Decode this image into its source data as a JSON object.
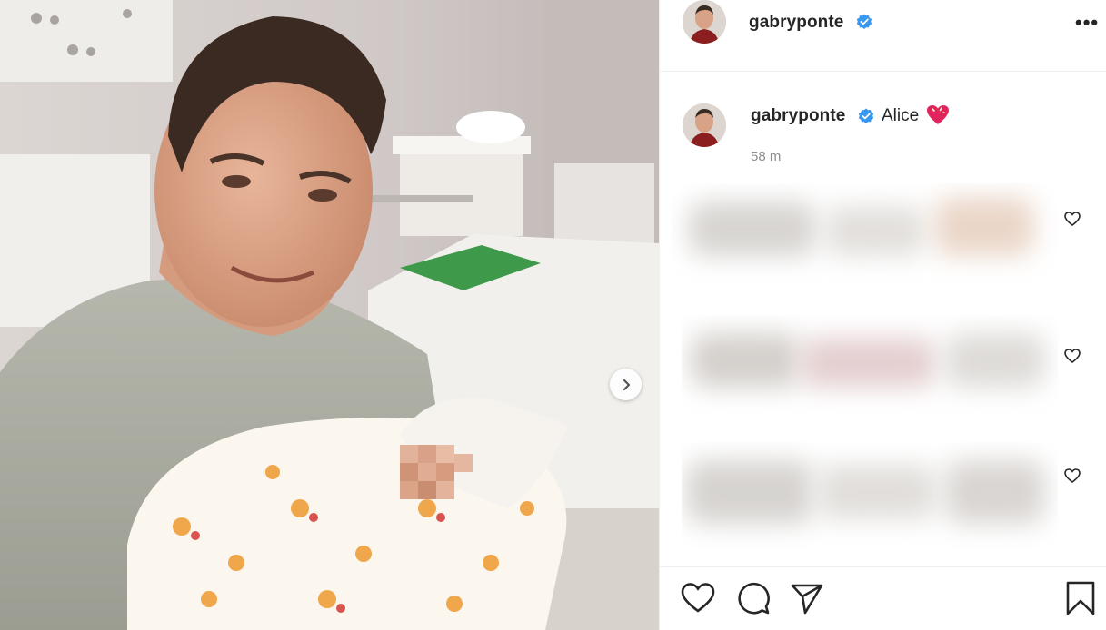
{
  "post": {
    "username": "gabryponte",
    "caption": "Alice",
    "caption_emoji": "sparkling-heart-emoji",
    "timestamp": "58 m",
    "verified": true
  },
  "header": {
    "more_label": "•••"
  },
  "media": {
    "next_icon": "chevron-right-icon",
    "description_hidden": true
  },
  "comments": [
    {
      "blurred": true,
      "like_icon": "heart-outline-icon"
    },
    {
      "blurred": true,
      "like_icon": "heart-outline-icon"
    },
    {
      "blurred": true,
      "like_icon": "heart-outline-icon"
    }
  ],
  "actions": {
    "icons": [
      "heart-outline-icon",
      "comment-icon",
      "share-icon",
      "bookmark-icon"
    ]
  },
  "colors": {
    "verified": "#3897f0",
    "text": "#262626",
    "muted": "#8e8e8e",
    "divider": "#efefef",
    "heart_emoji": "#e0245e"
  }
}
